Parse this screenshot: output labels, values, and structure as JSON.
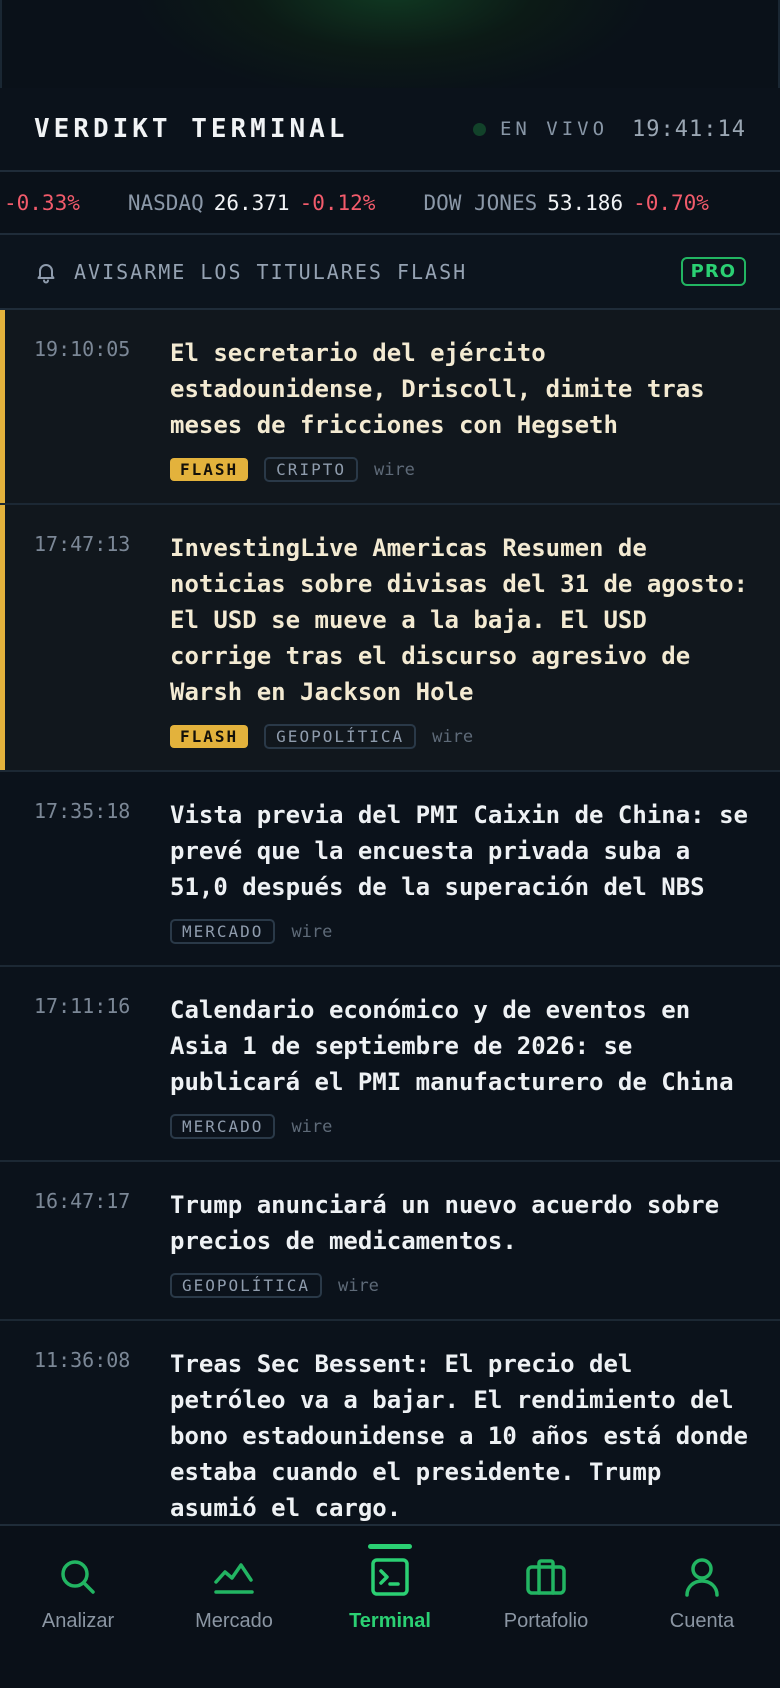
{
  "header": {
    "brand": "VERDIKT TERMINAL",
    "live_label": "EN VIVO",
    "clock": "19:41:14"
  },
  "ticker": [
    {
      "name": "",
      "value": "",
      "change": "-0.33%"
    },
    {
      "name": "NASDAQ",
      "value": "26.371",
      "change": "-0.12%"
    },
    {
      "name": "DOW JONES",
      "value": "53.186",
      "change": "-0.70%"
    }
  ],
  "alert": {
    "label": "AVISARME LOS TITULARES FLASH",
    "badge": "PRO",
    "icon": "bell-icon"
  },
  "feed": [
    {
      "time": "19:10:05",
      "title": "El secretario del ejército estadounidense, Driscoll, dimite tras meses de fricciones con Hegseth",
      "flash_label": "FLASH",
      "tag": "CRIPTO",
      "source": "wire"
    },
    {
      "time": "17:47:13",
      "title": "InvestingLive Americas Resumen de noticias sobre divisas del 31 de agosto: El USD se mueve a la baja. El USD corrige tras el discurso agresivo de Warsh en Jackson Hole",
      "flash_label": "FLASH",
      "tag": "GEOPOLÍTICA",
      "source": "wire"
    },
    {
      "time": "17:35:18",
      "title": "Vista previa del PMI Caixin de China: se prevé que la encuesta privada suba a 51,0 después de la superación del NBS",
      "tag": "MERCADO",
      "source": "wire"
    },
    {
      "time": "17:11:16",
      "title": "Calendario económico y de eventos en Asia 1 de septiembre de 2026: se publicará el PMI manufacturero de China",
      "tag": "MERCADO",
      "source": "wire"
    },
    {
      "time": "16:47:17",
      "title": "Trump anunciará un nuevo acuerdo sobre precios de medicamentos.",
      "tag": "GEOPOLÍTICA",
      "source": "wire"
    },
    {
      "time": "11:36:08",
      "title": "Treas Sec Bessent: El precio del petróleo va a bajar. El rendimiento del bono estadounidense a 10 años está donde estaba cuando el presidente. Trump asumió el cargo."
    }
  ],
  "nav": [
    {
      "label": "Analizar",
      "icon": "search-icon"
    },
    {
      "label": "Mercado",
      "icon": "chart-line-icon"
    },
    {
      "label": "Terminal",
      "icon": "terminal-icon",
      "active": true
    },
    {
      "label": "Portafolio",
      "icon": "briefcase-icon"
    },
    {
      "label": "Cuenta",
      "icon": "user-icon"
    }
  ],
  "colors": {
    "accent_green": "#2bd073",
    "negative_red": "#f25b6b",
    "flash_yellow": "#e3b23c",
    "background": "#0b121b"
  }
}
